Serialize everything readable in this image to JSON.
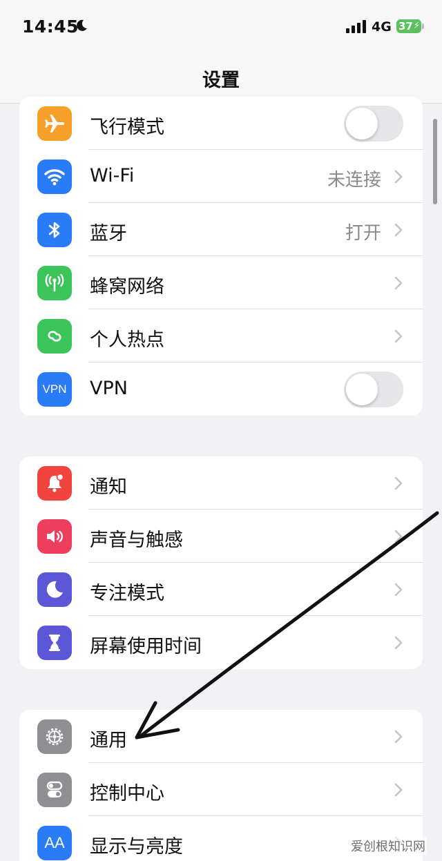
{
  "status_bar": {
    "time": "14:45",
    "network": "4G",
    "battery": "37"
  },
  "nav": {
    "title": "设置"
  },
  "groups": [
    [
      {
        "label": "飞行模式",
        "icon": "airplane-icon",
        "color": "#f7a029",
        "accessory": "toggle",
        "toggle_on": false
      },
      {
        "label": "Wi-Fi",
        "icon": "wifi-icon",
        "color": "#2a7cf6",
        "accessory": "chevron",
        "value": "未连接"
      },
      {
        "label": "蓝牙",
        "icon": "bluetooth-icon",
        "color": "#2a7cf6",
        "accessory": "chevron",
        "value": "打开"
      },
      {
        "label": "蜂窝网络",
        "icon": "cellular-icon",
        "color": "#3bc45a",
        "accessory": "chevron"
      },
      {
        "label": "个人热点",
        "icon": "hotspot-icon",
        "color": "#3bc45a",
        "accessory": "chevron"
      },
      {
        "label": "VPN",
        "icon": "vpn-icon",
        "color": "#2a7cf6",
        "accessory": "toggle",
        "toggle_on": false,
        "icon_text": "VPN"
      }
    ],
    [
      {
        "label": "通知",
        "icon": "notification-bell-icon",
        "color": "#f2433f",
        "accessory": "chevron"
      },
      {
        "label": "声音与触感",
        "icon": "speaker-icon",
        "color": "#ef3d5d",
        "accessory": "chevron"
      },
      {
        "label": "专注模式",
        "icon": "moon-icon",
        "color": "#5b57d6",
        "accessory": "chevron"
      },
      {
        "label": "屏幕使用时间",
        "icon": "hourglass-icon",
        "color": "#5b57d6",
        "accessory": "chevron"
      }
    ],
    [
      {
        "label": "通用",
        "icon": "gear-icon",
        "color": "#8e8e93",
        "accessory": "chevron"
      },
      {
        "label": "控制中心",
        "icon": "toggles-icon",
        "color": "#8e8e93",
        "accessory": "chevron"
      },
      {
        "label": "显示与亮度",
        "icon": "display-aa-icon",
        "color": "#2a7cf6",
        "accessory": "chevron",
        "icon_text": "AA"
      }
    ]
  ],
  "watermark": "爱创根知识网"
}
